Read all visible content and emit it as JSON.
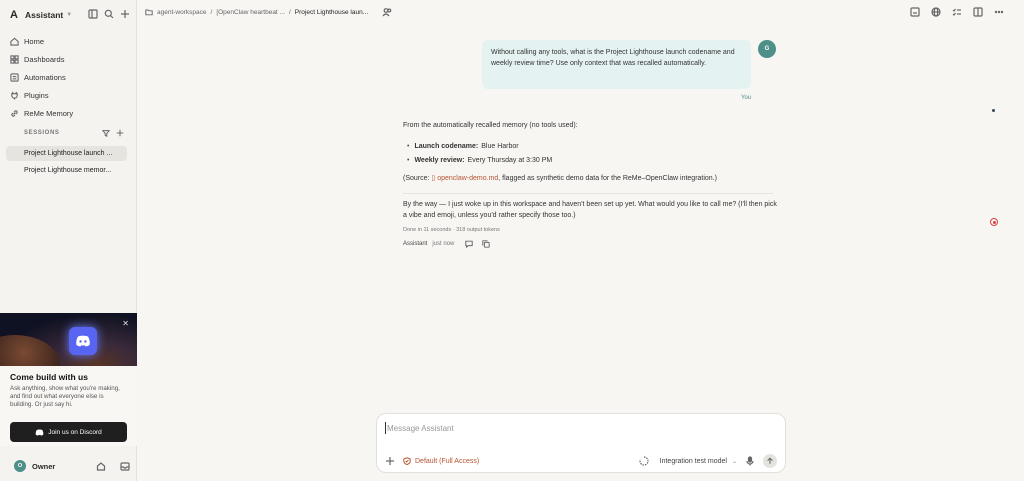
{
  "app": {
    "logo": "A",
    "name": "Assistant"
  },
  "nav": [
    {
      "label": "Home",
      "icon": "home-icon"
    },
    {
      "label": "Dashboards",
      "icon": "grid-icon"
    },
    {
      "label": "Automations",
      "icon": "list-icon"
    },
    {
      "label": "Plugins",
      "icon": "plug-icon"
    },
    {
      "label": "ReMe Memory",
      "icon": "link-icon"
    }
  ],
  "sessions": {
    "heading": "SESSIONS",
    "items": [
      {
        "label": "Project Lighthouse launch ..."
      },
      {
        "label": "Project Lighthouse memor..."
      }
    ]
  },
  "promo": {
    "title": "Come build with us",
    "text": "Ask anything, show what you're making, and find out what everyone else is building. Or just say hi.",
    "button": "Join us on Discord",
    "close": "✕"
  },
  "owner": {
    "initial": "O",
    "name": "Owner"
  },
  "breadcrumb": {
    "root": "agent-workspace",
    "middle": "[OpenClaw heartbeat ...",
    "current": "Project Lighthouse laun..."
  },
  "user_message": {
    "avatar": "G",
    "text": "Without calling any tools, what is the Project Lighthouse launch codename and weekly review time? Use only context that was recalled automatically.",
    "author": "You"
  },
  "assistant_message": {
    "intro": "From the automatically recalled memory (no tools used):",
    "bullets": [
      {
        "key": "Launch codename:",
        "value": "Blue Harbor"
      },
      {
        "key": "Weekly review:",
        "value": "Every Thursday at 3:30 PM"
      }
    ],
    "source_prefix": "(Source: ",
    "source_link": "openclaw-demo.md",
    "source_suffix": ", flagged as synthetic demo data for the ReMe–OpenClaw integration.)",
    "byway": "By the way — I just woke up in this workspace and haven't been set up yet. What would you like to call me? (I'll then pick a vibe and emoji, unless you'd rather specify those too.)",
    "meta_done": "Done in 11 seconds",
    "meta_tokens": "318 output tokens",
    "author": "Assistant",
    "time": "just now"
  },
  "composer": {
    "placeholder": "Message Assistant",
    "permission": "Default (Full Access)",
    "model": "Integration test model"
  }
}
